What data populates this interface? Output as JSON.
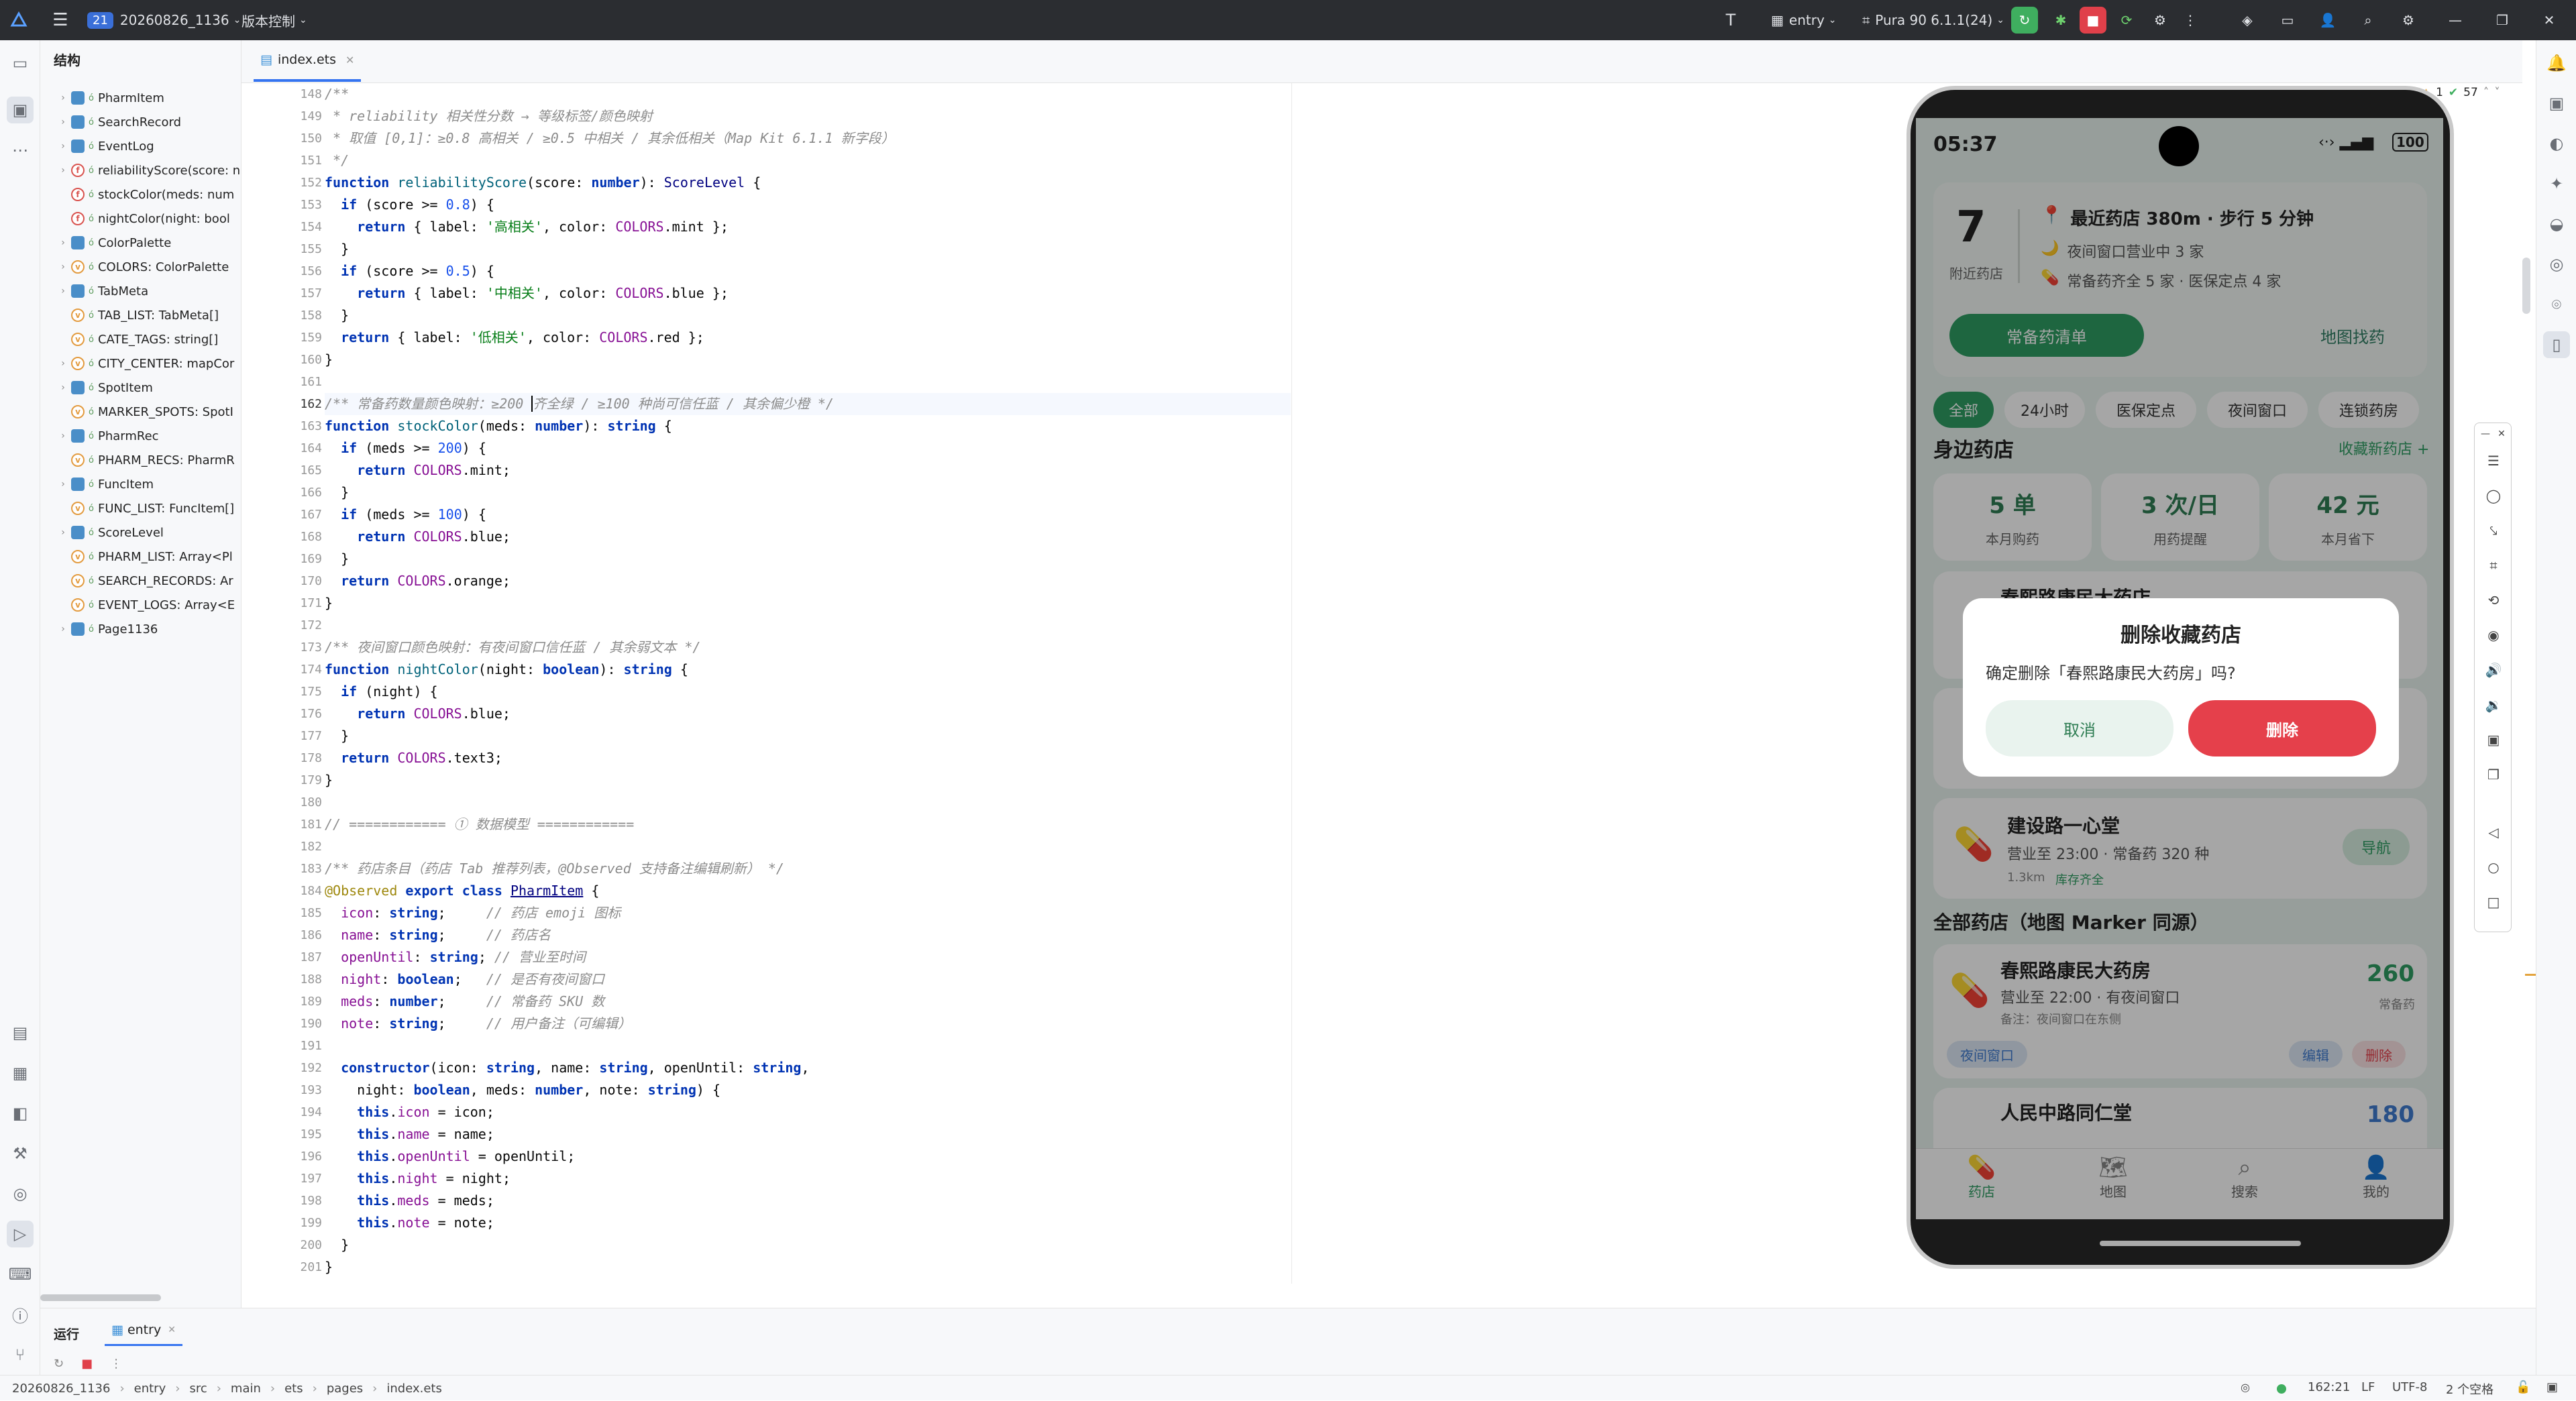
{
  "topbar": {
    "project_badge": "21",
    "project_name": "20260826_1136",
    "vcs": "版本控制",
    "run_config": "entry",
    "device": "Pura 90 6.1.1(24)"
  },
  "structure": {
    "title": "结构",
    "items": [
      {
        "name": "PharmItem",
        "kind": "c",
        "expand": true
      },
      {
        "name": "SearchRecord",
        "kind": "c",
        "expand": true
      },
      {
        "name": "EventLog",
        "kind": "c",
        "expand": true
      },
      {
        "name": "reliabilityScore(score: n",
        "kind": "f",
        "expand": true
      },
      {
        "name": "stockColor(meds: num",
        "kind": "f",
        "expand": false
      },
      {
        "name": "nightColor(night: bool",
        "kind": "f",
        "expand": false
      },
      {
        "name": "ColorPalette",
        "kind": "c",
        "expand": true
      },
      {
        "name": "COLORS: ColorPalette",
        "kind": "v",
        "expand": true
      },
      {
        "name": "TabMeta",
        "kind": "c",
        "expand": true
      },
      {
        "name": "TAB_LIST: TabMeta[]",
        "kind": "v",
        "expand": false
      },
      {
        "name": "CATE_TAGS: string[]",
        "kind": "v",
        "expand": false
      },
      {
        "name": "CITY_CENTER: mapCor",
        "kind": "v",
        "expand": true
      },
      {
        "name": "SpotItem",
        "kind": "c",
        "expand": true
      },
      {
        "name": "MARKER_SPOTS: SpotI",
        "kind": "v",
        "expand": false
      },
      {
        "name": "PharmRec",
        "kind": "c",
        "expand": true
      },
      {
        "name": "PHARM_RECS: PharmR",
        "kind": "v",
        "expand": false
      },
      {
        "name": "FuncItem",
        "kind": "c",
        "expand": true
      },
      {
        "name": "FUNC_LIST: FuncItem[]",
        "kind": "v",
        "expand": false
      },
      {
        "name": "ScoreLevel",
        "kind": "c",
        "expand": true
      },
      {
        "name": "PHARM_LIST: Array<Pl",
        "kind": "v",
        "expand": false
      },
      {
        "name": "SEARCH_RECORDS: Ar",
        "kind": "v",
        "expand": false
      },
      {
        "name": "EVENT_LOGS: Array<E",
        "kind": "v",
        "expand": false
      },
      {
        "name": "Page1136",
        "kind": "c",
        "expand": true
      }
    ]
  },
  "tab": {
    "filename": "index.ets"
  },
  "editor": {
    "inspection_count": "57",
    "warn_count": "1",
    "line_numbers": [
      "148",
      "149",
      "150",
      "151",
      "152",
      "153",
      "154",
      "155",
      "156",
      "157",
      "158",
      "159",
      "160",
      "161",
      "162",
      "163",
      "164",
      "165",
      "166",
      "167",
      "168",
      "169",
      "170",
      "171",
      "172",
      "173",
      "174",
      "175",
      "176",
      "177",
      "178",
      "179",
      "180",
      "181",
      "182",
      "183",
      "184",
      "185",
      "186",
      "187",
      "188",
      "189",
      "190",
      "191",
      "192",
      "193",
      "194",
      "195",
      "196",
      "197",
      "198",
      "199",
      "200",
      "201"
    ]
  },
  "phone": {
    "time": "05:37",
    "battery": "100",
    "hero": {
      "count": "7",
      "count_label": "附近药店",
      "line1": "最近药店 380m · 步行 5 分钟",
      "line2": "夜间窗口营业中 3 家",
      "line3": "常备药齐全 5 家 · 医保定点 4 家",
      "btn_primary": "常备药清单",
      "btn_secondary": "地图找药"
    },
    "chips": [
      "全部",
      "24小时",
      "医保定点",
      "夜间窗口",
      "连锁药房"
    ],
    "nearby": {
      "title": "身边药店",
      "action": "收藏新药店 +",
      "stats": [
        {
          "value": "5 单",
          "label": "本月购药"
        },
        {
          "value": "3 次/日",
          "label": "用药提醒"
        },
        {
          "value": "42 元",
          "label": "本月省下"
        }
      ],
      "peek_title": "春熙路康民大药店",
      "store3_name": "建设路一心堂",
      "store3_info": "营业至 23:00 · 常备药 320 种",
      "store3_dist": "1.3km",
      "store3_tag": "库存齐全",
      "store3_btn": "导航"
    },
    "all": {
      "title": "全部药店（地图 Marker 同源）",
      "store1_name": "春熙路康民大药房",
      "store1_info": "营业至 22:00 · 有夜间窗口",
      "store1_note": "备注：夜间窗口在东侧",
      "store1_meds": "260",
      "store1_meds_label": "常备药",
      "store1_tag": "夜间窗口",
      "store1_edit": "编辑",
      "store1_del": "删除",
      "store2_name": "人民中路同仁堂",
      "store2_meds": "180"
    },
    "tabs": [
      "药店",
      "地图",
      "搜索",
      "我的"
    ],
    "dialog": {
      "title": "删除收藏药店",
      "message": "确定删除「春熙路康民大药房」吗?",
      "cancel": "取消",
      "confirm": "删除"
    }
  },
  "bottom": {
    "run_label": "运行",
    "run_tab": "entry"
  },
  "status": {
    "crumbs": [
      "20260826_1136",
      "entry",
      "src",
      "main",
      "ets",
      "pages",
      "index.ets"
    ],
    "position": "162:21",
    "line_sep": "LF",
    "encoding": "UTF-8",
    "indent": "2 个空格"
  },
  "colors": {
    "accent_green": "#2e9d63",
    "danger_red": "#e5404b",
    "link_blue": "#3f7bd0"
  }
}
